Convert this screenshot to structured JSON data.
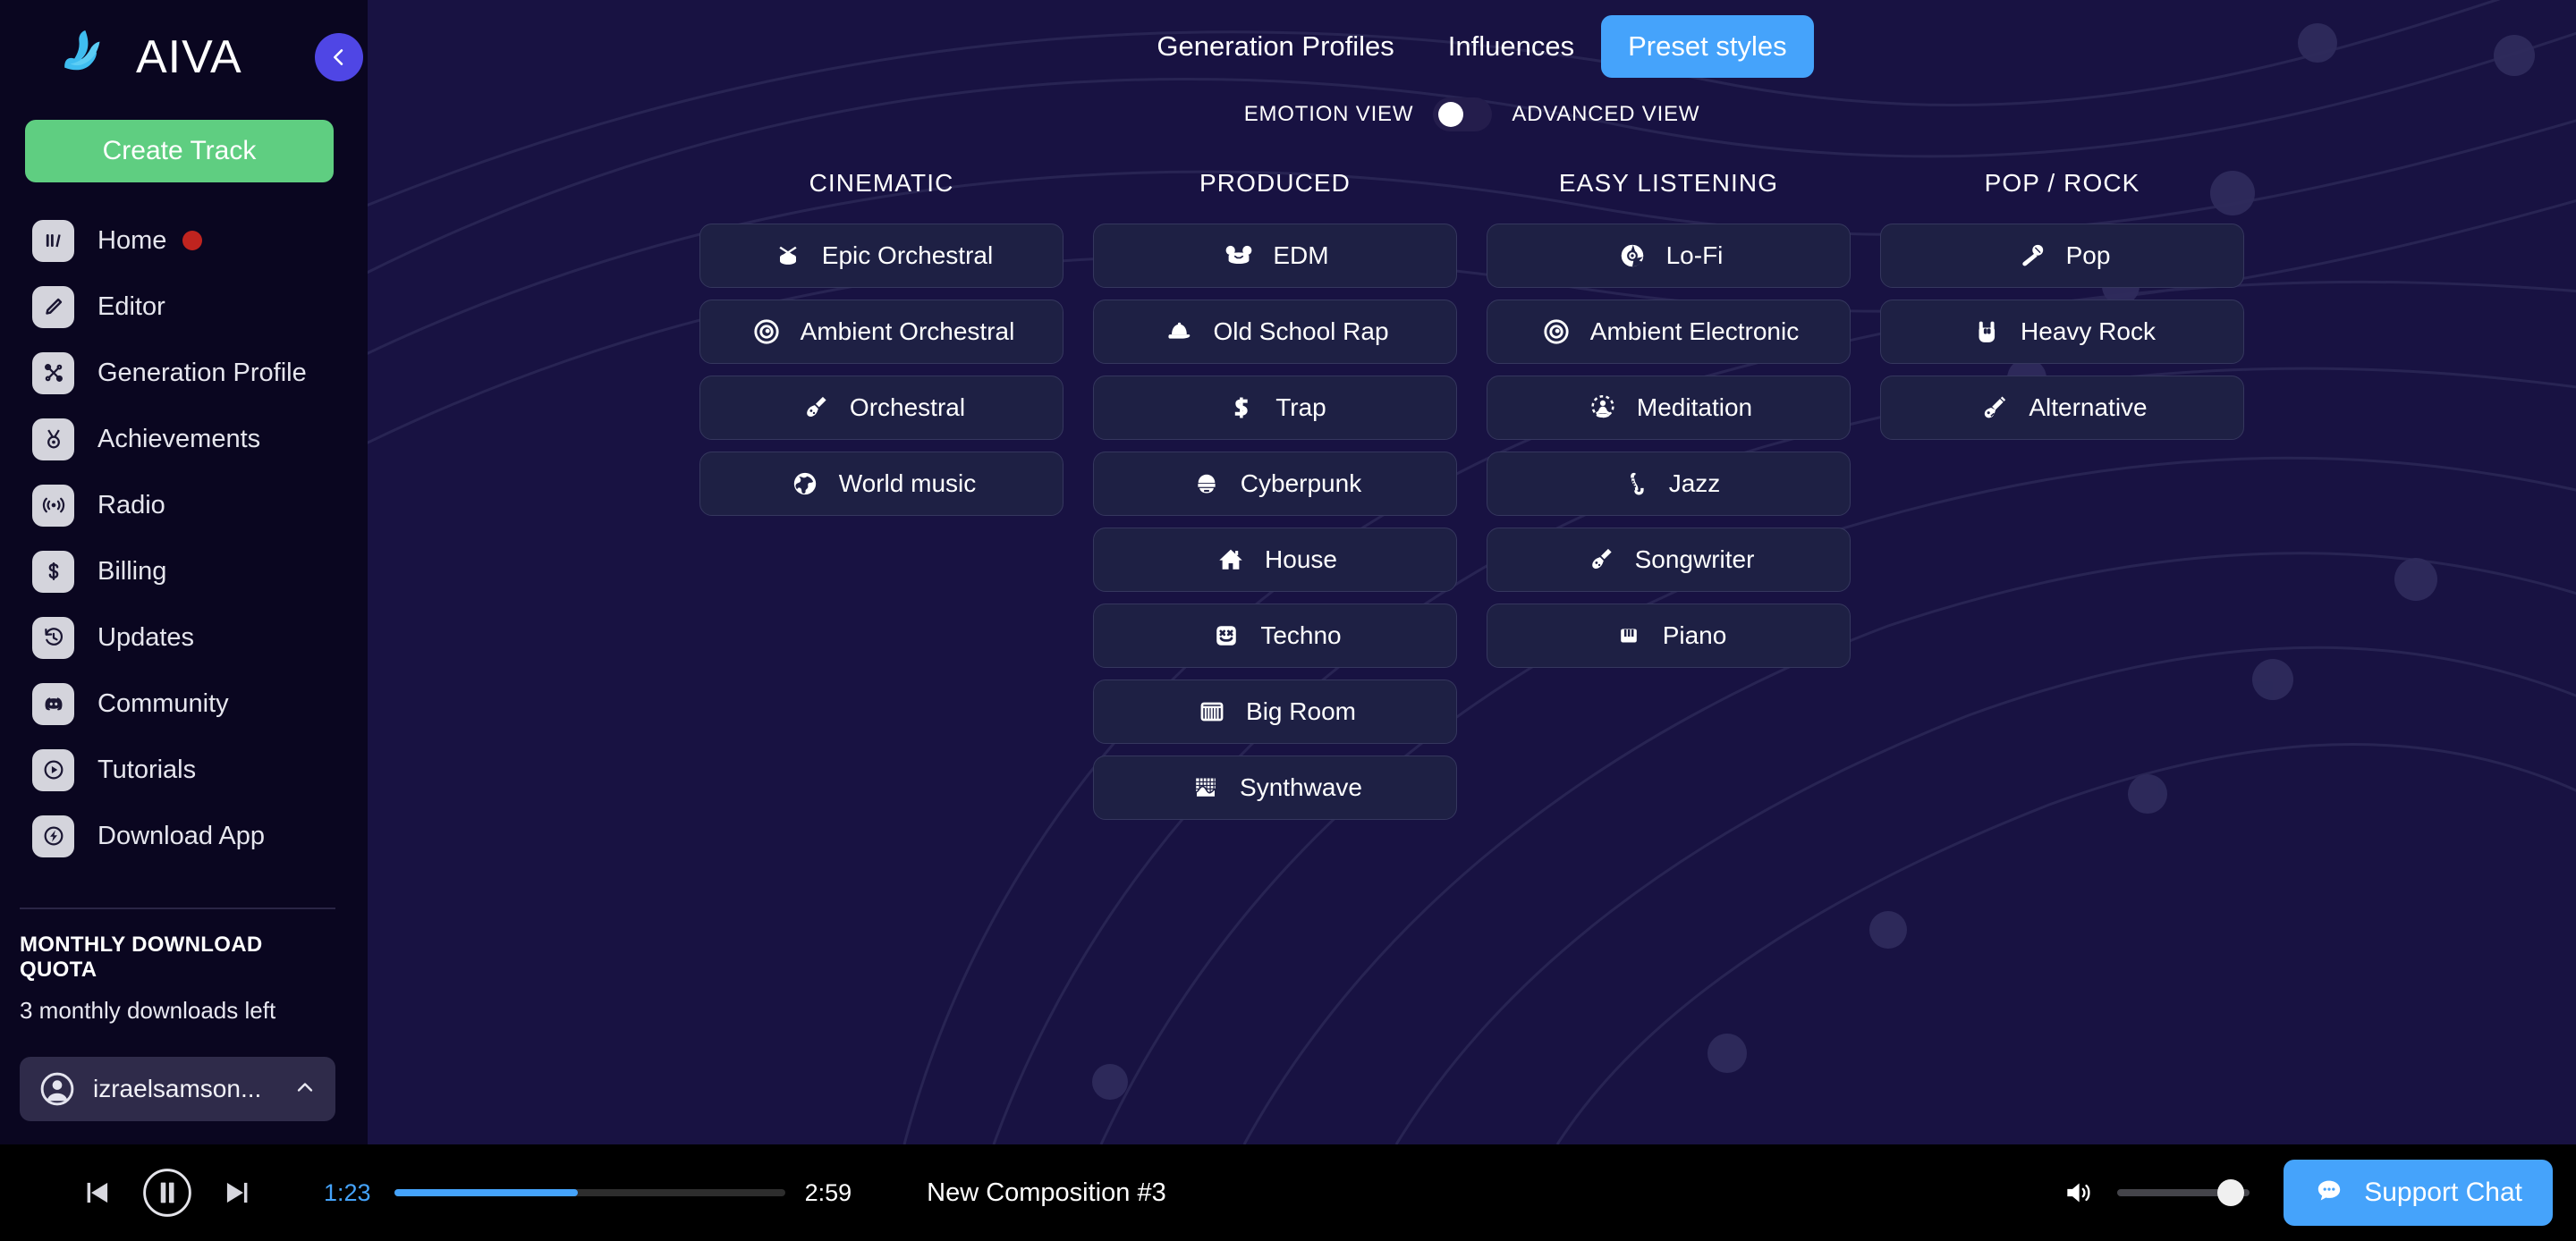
{
  "brand": {
    "name": "AIVA",
    "logo_icon": "aiva-logo-icon",
    "collapse_icon": "chevron-left-icon"
  },
  "sidebar": {
    "create_track_label": "Create Track",
    "items": [
      {
        "label": "Home",
        "icon": "home-waveform-icon",
        "badge": true
      },
      {
        "label": "Editor",
        "icon": "pencil-icon",
        "badge": false
      },
      {
        "label": "Generation Profile",
        "icon": "generation-profile-icon",
        "badge": false
      },
      {
        "label": "Achievements",
        "icon": "medal-icon",
        "badge": false
      },
      {
        "label": "Radio",
        "icon": "radio-broadcast-icon",
        "badge": false
      },
      {
        "label": "Billing",
        "icon": "dollar-icon",
        "badge": false
      },
      {
        "label": "Updates",
        "icon": "history-clock-icon",
        "badge": false
      },
      {
        "label": "Community",
        "icon": "discord-icon",
        "badge": false
      },
      {
        "label": "Tutorials",
        "icon": "play-circle-icon",
        "badge": false
      },
      {
        "label": "Download App",
        "icon": "download-bolt-icon",
        "badge": false
      }
    ],
    "quota": {
      "title": "MONTHLY DOWNLOAD QUOTA",
      "text": "3 monthly downloads left"
    },
    "user": {
      "name": "izraelsamson...",
      "avatar_icon": "avatar-icon",
      "chevron_icon": "chevron-up-icon"
    }
  },
  "header": {
    "tabs": [
      {
        "label": "Generation Profiles",
        "active": false
      },
      {
        "label": "Influences",
        "active": false
      },
      {
        "label": "Preset styles",
        "active": true
      }
    ],
    "view_toggle": {
      "left_label": "EMOTION VIEW",
      "right_label": "ADVANCED VIEW",
      "state": "left"
    }
  },
  "columns": [
    {
      "title": "CINEMATIC",
      "styles": [
        {
          "label": "Epic Orchestral",
          "icon": "drum-icon"
        },
        {
          "label": "Ambient Orchestral",
          "icon": "target-ring-icon"
        },
        {
          "label": "Orchestral",
          "icon": "violin-icon"
        },
        {
          "label": "World music",
          "icon": "globe-icon"
        }
      ]
    },
    {
      "title": "PRODUCED",
      "styles": [
        {
          "label": "EDM",
          "icon": "mouse-head-icon"
        },
        {
          "label": "Old School Rap",
          "icon": "cap-icon"
        },
        {
          "label": "Trap",
          "icon": "dollar-sign-icon"
        },
        {
          "label": "Cyberpunk",
          "icon": "robot-helmet-icon"
        },
        {
          "label": "House",
          "icon": "house-icon"
        },
        {
          "label": "Techno",
          "icon": "marshmello-face-icon"
        },
        {
          "label": "Big Room",
          "icon": "keyboard-keys-icon"
        },
        {
          "label": "Synthwave",
          "icon": "grid-wave-icon"
        }
      ]
    },
    {
      "title": "EASY LISTENING",
      "styles": [
        {
          "label": "Lo-Fi",
          "icon": "vinyl-record-icon"
        },
        {
          "label": "Ambient Electronic",
          "icon": "target-ring-icon"
        },
        {
          "label": "Meditation",
          "icon": "lotus-meditation-icon"
        },
        {
          "label": "Jazz",
          "icon": "saxophone-icon"
        },
        {
          "label": "Songwriter",
          "icon": "acoustic-guitar-icon"
        },
        {
          "label": "Piano",
          "icon": "piano-icon"
        }
      ]
    },
    {
      "title": "POP / ROCK",
      "styles": [
        {
          "label": "Pop",
          "icon": "microphone-icon"
        },
        {
          "label": "Heavy Rock",
          "icon": "rock-hand-icon"
        },
        {
          "label": "Alternative",
          "icon": "electric-guitar-icon"
        }
      ]
    }
  ],
  "player": {
    "prev_icon": "skip-previous-icon",
    "playpause_icon": "pause-icon",
    "next_icon": "skip-next-icon",
    "current_time": "1:23",
    "total_time": "2:59",
    "progress_percent": 47,
    "track_title": "New Composition #3",
    "volume_icon": "volume-icon",
    "volume_percent": 86,
    "support": {
      "label": "Support Chat",
      "icon": "chat-bubble-icon"
    }
  },
  "colors": {
    "sidebar_bg": "#0a0620",
    "main_bg": "#181242",
    "accent_blue": "#45a3fb",
    "create_green": "#5fce81",
    "collapse_purple": "#4f46e5",
    "badge_red": "#c0241f",
    "card_bg": "#1e2044",
    "card_border": "#35375e",
    "player_bg": "#000000"
  }
}
